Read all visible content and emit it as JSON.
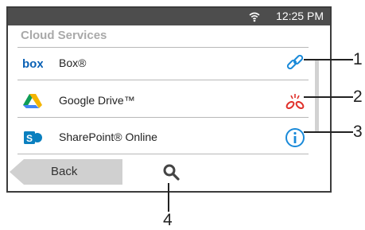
{
  "status_bar": {
    "time": "12:25 PM",
    "wifi_icon": "wifi-icon"
  },
  "header": {
    "title": "Cloud Services"
  },
  "services": [
    {
      "label": "Box®",
      "icon": "box-logo-icon",
      "status_icon": "link-icon"
    },
    {
      "label": "Google Drive™",
      "icon": "google-drive-logo-icon",
      "status_icon": "broken-link-icon"
    },
    {
      "label": "SharePoint® Online",
      "icon": "sharepoint-logo-icon",
      "status_icon": "info-icon"
    }
  ],
  "footer": {
    "back_label": "Back",
    "search_icon": "search-icon"
  },
  "callouts": [
    "1",
    "2",
    "3",
    "4"
  ],
  "colors": {
    "status_bar": "#4d4d4d",
    "link_blue": "#1a8ad9",
    "broken_link_red": "#e0302a",
    "box_blue": "#0a61b5",
    "sharepoint_blue": "#0a7fbf"
  }
}
